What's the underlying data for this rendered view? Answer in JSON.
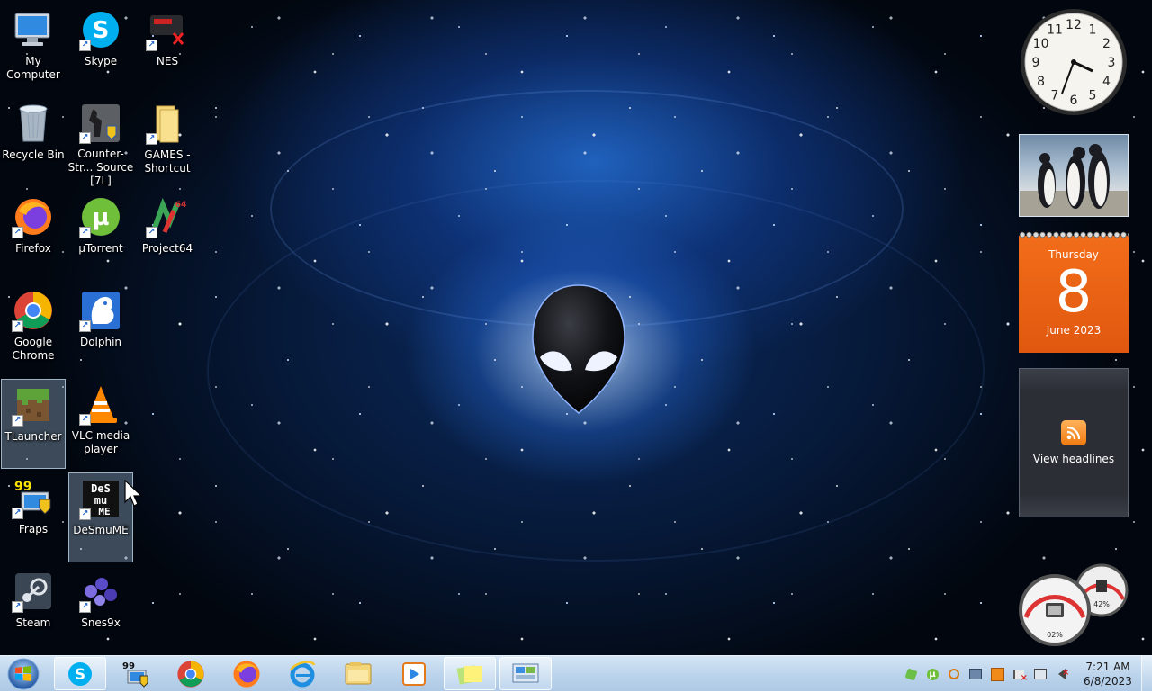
{
  "desktop": {
    "wallpaper": "alienware-space",
    "icons": [
      {
        "label": "My Computer",
        "icon": "computer-icon",
        "shortcut": false
      },
      {
        "label": "Skype",
        "icon": "skype-icon",
        "shortcut": true
      },
      {
        "label": "NES",
        "icon": "nes-icon",
        "shortcut": true
      },
      {
        "label": "Recycle Bin",
        "icon": "recycle-bin-icon",
        "shortcut": false
      },
      {
        "label": "Counter-Str... Source [7L]",
        "icon": "counter-strike-icon",
        "shortcut": true
      },
      {
        "label": "GAMES - Shortcut",
        "icon": "folder-icon",
        "shortcut": true
      },
      {
        "label": "Firefox",
        "icon": "firefox-icon",
        "shortcut": true
      },
      {
        "label": "µTorrent",
        "icon": "utorrent-icon",
        "shortcut": true
      },
      {
        "label": "Project64",
        "icon": "project64-icon",
        "shortcut": true
      },
      {
        "label": "Google Chrome",
        "icon": "chrome-icon",
        "shortcut": true
      },
      {
        "label": "Dolphin",
        "icon": "dolphin-icon",
        "shortcut": true
      },
      {
        "label": "TLauncher",
        "icon": "tlauncher-icon",
        "shortcut": true,
        "selected": true
      },
      {
        "label": "VLC media player",
        "icon": "vlc-icon",
        "shortcut": true
      },
      {
        "label": "Fraps",
        "icon": "fraps-icon",
        "shortcut": true
      },
      {
        "label": "DeSmuME",
        "icon": "desmume-icon",
        "shortcut": true,
        "selected": true
      },
      {
        "label": "Steam",
        "icon": "steam-icon",
        "shortcut": true
      },
      {
        "label": "Snes9x",
        "icon": "snes9x-icon",
        "shortcut": true
      }
    ]
  },
  "gadgets": {
    "clock": {
      "time": "7:21",
      "numerals": [
        "12",
        "1",
        "2",
        "3",
        "4",
        "5",
        "6",
        "7",
        "8",
        "9",
        "10",
        "11"
      ]
    },
    "slideshow": {
      "subject": "penguins"
    },
    "calendar": {
      "weekday": "Thursday",
      "day": "8",
      "month_year": "June 2023"
    },
    "feed": {
      "label": "View headlines"
    },
    "cpu_meter": {
      "cpu": "02%",
      "memory": "42%"
    }
  },
  "taskbar": {
    "start": "windows-start-orb",
    "items": [
      {
        "icon": "skype-icon",
        "running": true
      },
      {
        "icon": "fraps-icon",
        "running": false,
        "badge": "99"
      },
      {
        "icon": "chrome-icon",
        "running": false
      },
      {
        "icon": "firefox-icon",
        "running": false
      },
      {
        "icon": "internet-explorer-icon",
        "running": false
      },
      {
        "icon": "file-explorer-icon",
        "running": false
      },
      {
        "icon": "media-player-icon",
        "running": false
      },
      {
        "icon": "sticky-notes-icon",
        "running": true
      },
      {
        "icon": "control-panel-icon",
        "running": true
      }
    ],
    "tray": {
      "icons": [
        "green-app-icon",
        "utorrent-tray-icon",
        "search-tray-icon",
        "network-tray-icon",
        "gadget-tray-icon",
        "flag-error-icon",
        "network-disconnected-icon",
        "volume-muted-icon"
      ],
      "time": "7:21 AM",
      "date": "6/8/2023"
    }
  },
  "colors": {
    "calendar_orange": "#f26d1a",
    "taskbar_glass": "#c4d8ee",
    "selection": "#aac8e6"
  }
}
